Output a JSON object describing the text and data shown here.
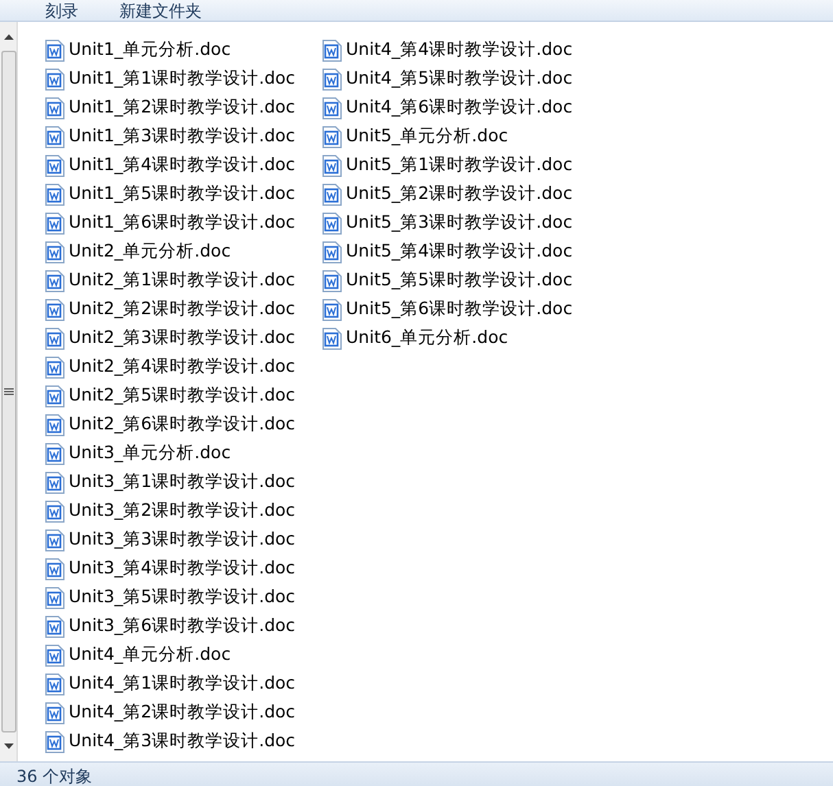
{
  "toolbar": {
    "buttons": [
      "刻录",
      "新建文件夹"
    ]
  },
  "files": [
    {
      "name": "Unit1_单元分析.doc"
    },
    {
      "name": "Unit1_第1课时教学设计.doc"
    },
    {
      "name": "Unit1_第2课时教学设计.doc"
    },
    {
      "name": "Unit1_第3课时教学设计.doc"
    },
    {
      "name": "Unit1_第4课时教学设计.doc"
    },
    {
      "name": "Unit1_第5课时教学设计.doc"
    },
    {
      "name": "Unit1_第6课时教学设计.doc"
    },
    {
      "name": "Unit2_单元分析.doc"
    },
    {
      "name": "Unit2_第1课时教学设计.doc"
    },
    {
      "name": "Unit2_第2课时教学设计.doc"
    },
    {
      "name": "Unit2_第3课时教学设计.doc"
    },
    {
      "name": "Unit2_第4课时教学设计.doc"
    },
    {
      "name": "Unit2_第5课时教学设计.doc"
    },
    {
      "name": "Unit2_第6课时教学设计.doc"
    },
    {
      "name": "Unit3_单元分析.doc"
    },
    {
      "name": "Unit3_第1课时教学设计.doc"
    },
    {
      "name": "Unit3_第2课时教学设计.doc"
    },
    {
      "name": "Unit3_第3课时教学设计.doc"
    },
    {
      "name": "Unit3_第4课时教学设计.doc"
    },
    {
      "name": "Unit3_第5课时教学设计.doc"
    },
    {
      "name": "Unit3_第6课时教学设计.doc"
    },
    {
      "name": "Unit4_单元分析.doc"
    },
    {
      "name": "Unit4_第1课时教学设计.doc"
    },
    {
      "name": "Unit4_第2课时教学设计.doc"
    },
    {
      "name": "Unit4_第3课时教学设计.doc"
    },
    {
      "name": "Unit4_第4课时教学设计.doc"
    },
    {
      "name": "Unit4_第5课时教学设计.doc"
    },
    {
      "name": "Unit4_第6课时教学设计.doc"
    },
    {
      "name": "Unit5_单元分析.doc"
    },
    {
      "name": "Unit5_第1课时教学设计.doc"
    },
    {
      "name": "Unit5_第2课时教学设计.doc"
    },
    {
      "name": "Unit5_第3课时教学设计.doc"
    },
    {
      "name": "Unit5_第4课时教学设计.doc"
    },
    {
      "name": "Unit5_第5课时教学设计.doc"
    },
    {
      "name": "Unit5_第6课时教学设计.doc"
    },
    {
      "name": "Unit6_单元分析.doc"
    }
  ],
  "status_bar": {
    "text": "36 个对象"
  }
}
